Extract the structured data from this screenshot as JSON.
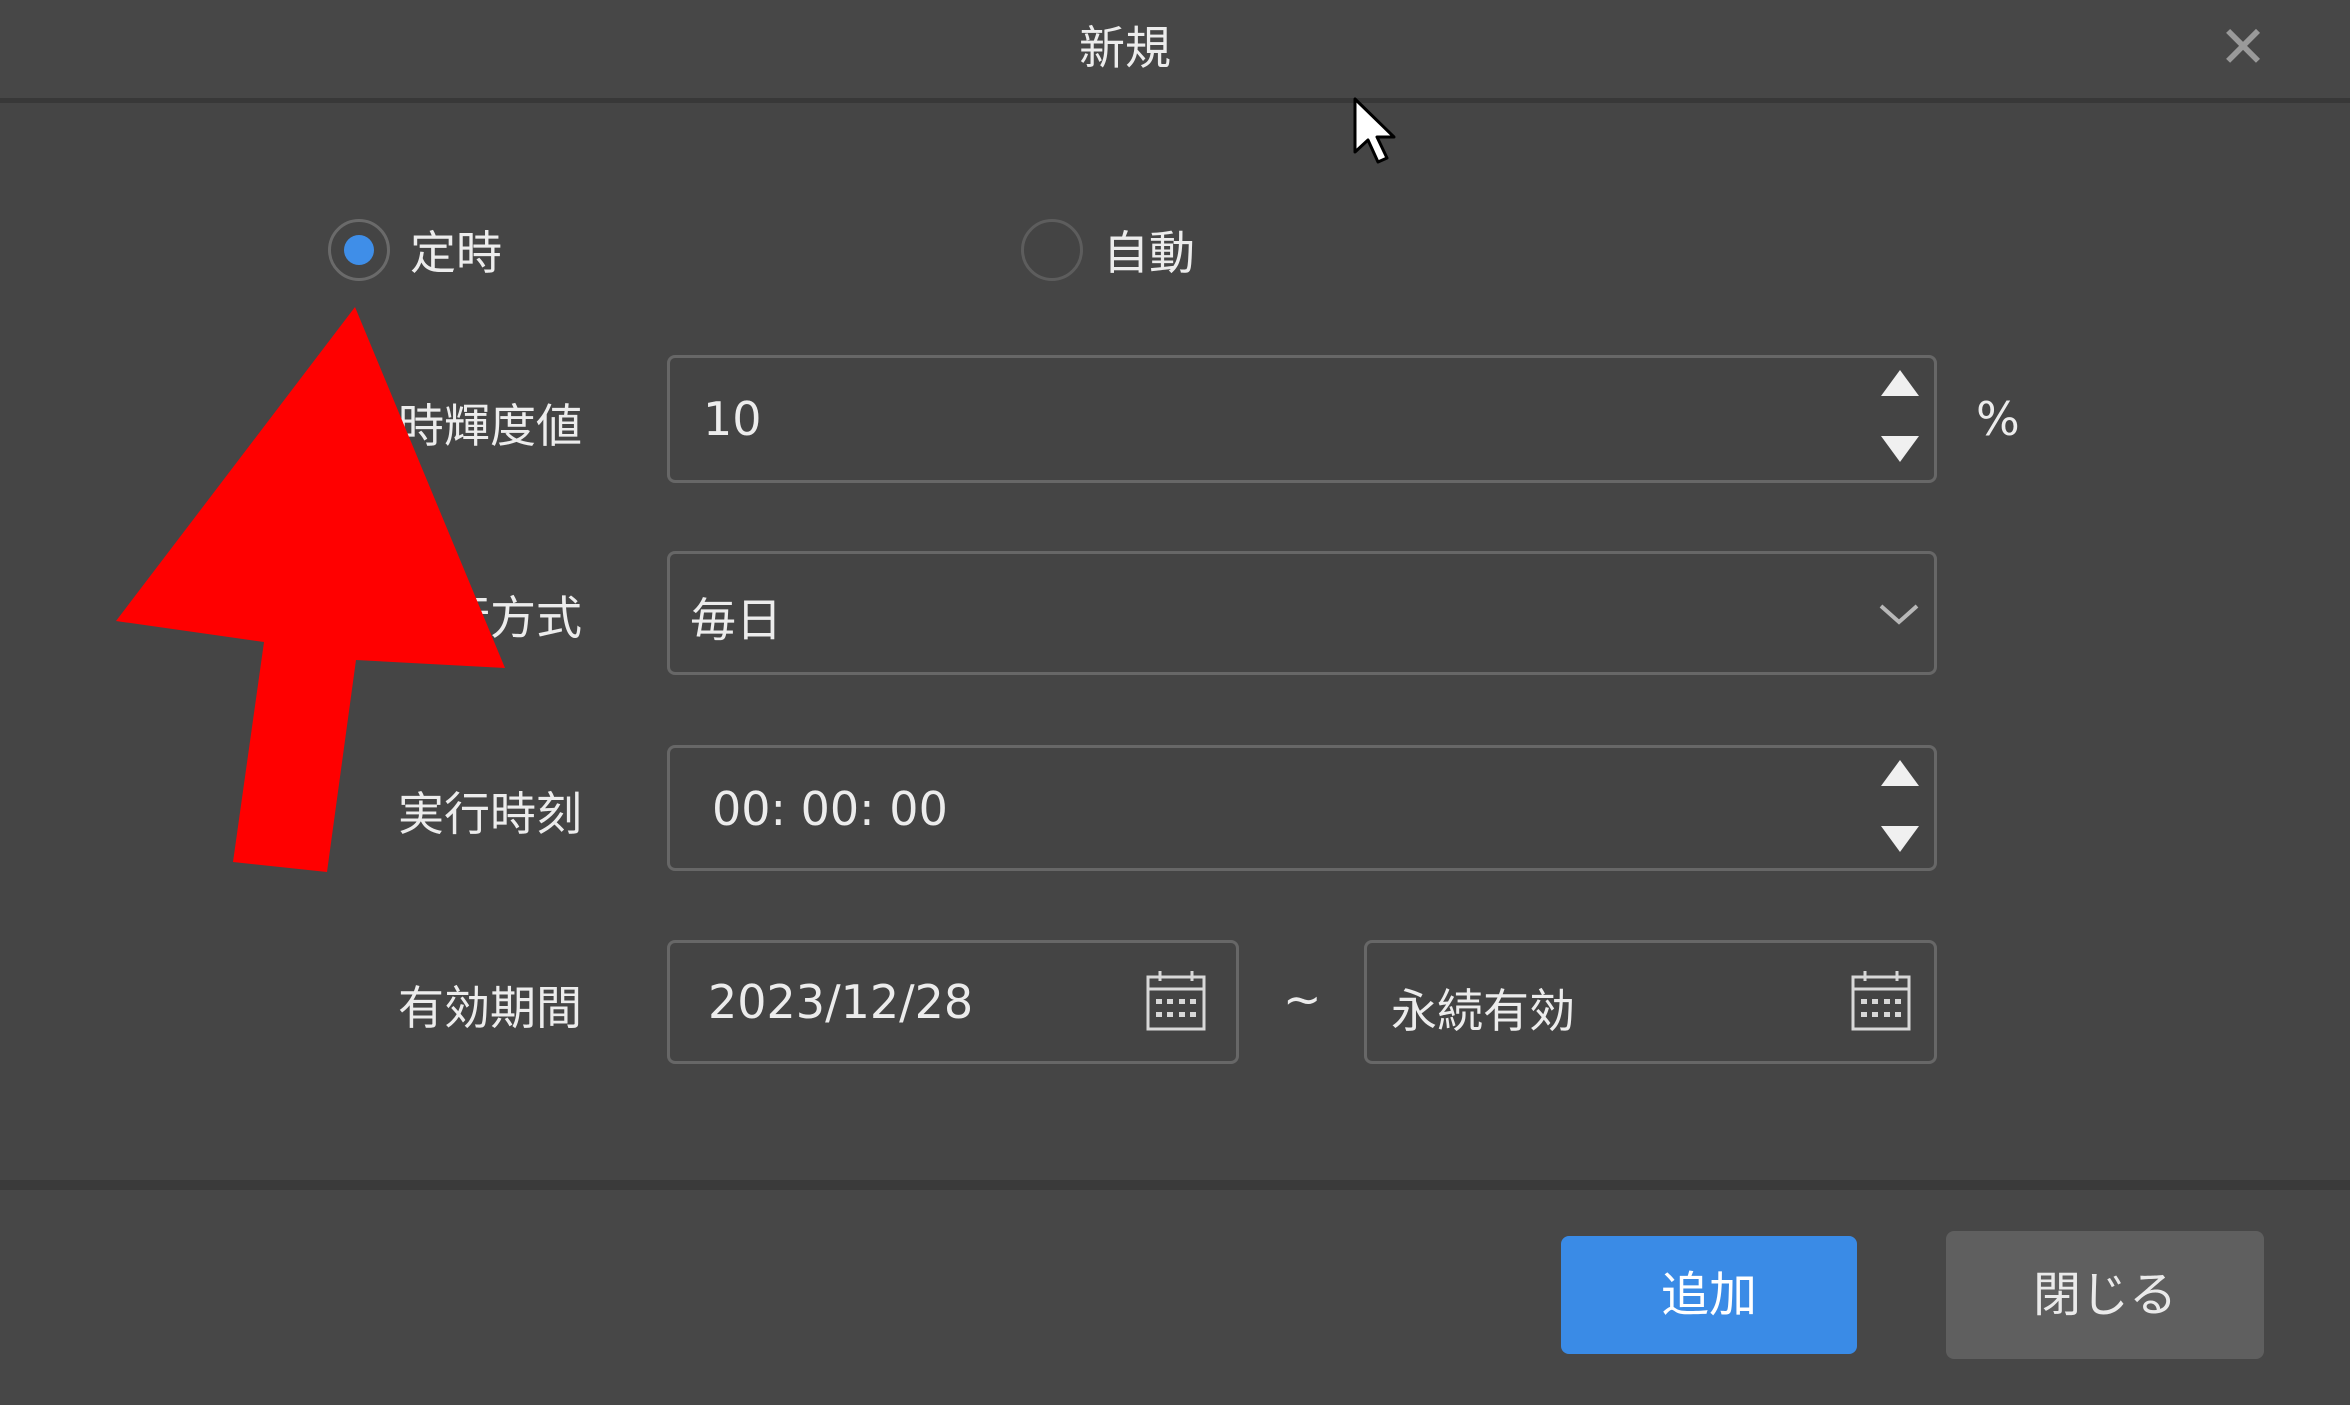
{
  "dialog": {
    "title": "新規",
    "close_icon": "close-icon"
  },
  "mode": {
    "options": [
      {
        "label": "定時",
        "checked": true
      },
      {
        "label": "自動",
        "checked": false
      }
    ]
  },
  "brightness": {
    "label": "定時輝度値",
    "value": "10",
    "unit": "%"
  },
  "method": {
    "label": "実行方式",
    "value": "毎日"
  },
  "exec_time": {
    "label": "実行時刻",
    "value": "00: 00: 00"
  },
  "validity": {
    "label": "有効期間",
    "start": "2023/12/28",
    "separator": "~",
    "end": "永続有効"
  },
  "buttons": {
    "add": "追加",
    "close": "閉じる"
  },
  "colors": {
    "accent": "#3a8be6",
    "annotation_arrow": "#ff0000",
    "background": "#454545"
  }
}
